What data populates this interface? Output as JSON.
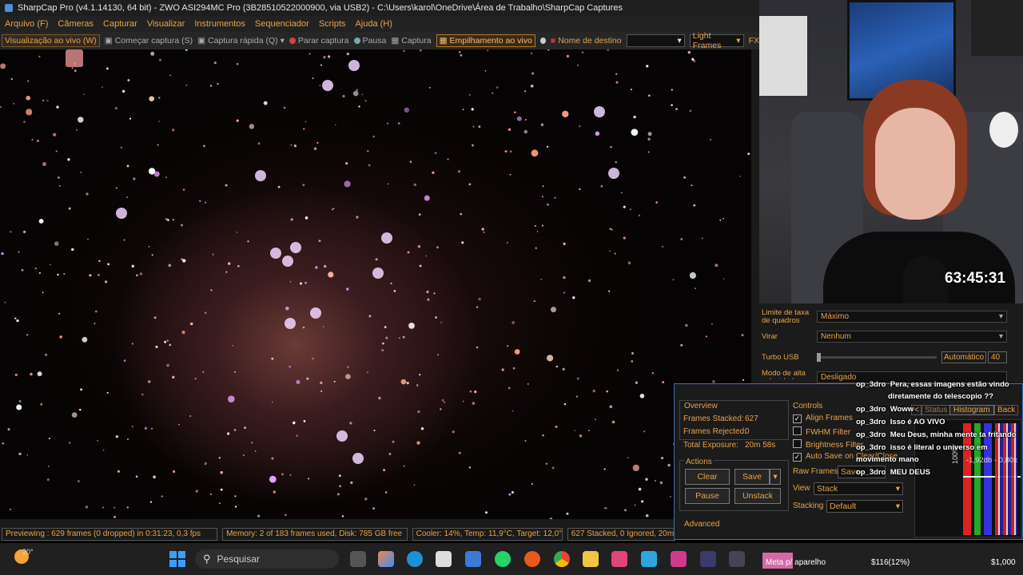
{
  "titlebar": {
    "title": "SharpCap Pro (v4.1.14130, 64 bit) - ZWO ASI294MC Pro (3B28510522000900, via USB2) - C:\\Users\\karol\\OneDrive\\Área de Trabalho\\SharpCap Captures"
  },
  "menu": [
    "Arquivo (F)",
    "Câmeras",
    "Capturar",
    "Visualizar",
    "Instrumentos",
    "Sequenciador",
    "Scripts",
    "Ajuda (H)"
  ],
  "toolbar": {
    "live_view": "Visualização ao vivo (W)",
    "start_capture": "Começar captura (S)",
    "quick_capture": "Captura rápida (Q)",
    "stop_capture": "Parar captura",
    "pause": "Pausa",
    "capture": "Captura",
    "live_stack": "Empilhamento ao vivo",
    "target_name": "Nome de destino",
    "target_value": "",
    "frame_type": "Light Frames",
    "fx": "FX"
  },
  "statusbar": {
    "preview": "Previewing : 629 frames (0 dropped) in 0:31:23, 0,3 fps",
    "memory": "Memory: 2 of 183 frames used, Disk: 785 GB free",
    "cooler": "Cooler: 14%, Temp: 11,9°C, Target: 12,0°C",
    "stack": "627 Stacked, 0 Ignored, 20m 5"
  },
  "webcam": {
    "timer": "63:45:31"
  },
  "settings": {
    "frame_rate_label": "Limite de taxa de quadros",
    "frame_rate_value": "Máximo",
    "flip_label": "Virar",
    "flip_value": "Nenhum",
    "usb_label": "Turbo USB",
    "usb_auto": "Automático",
    "usb_value": "40",
    "highspeed_label": "Modo de alta velocidade",
    "highspeed_value": "Desligado"
  },
  "stacking": {
    "overview_title": "Overview",
    "frames_stacked_label": "Frames Stacked:",
    "frames_stacked": "627",
    "frames_rejected_label": "Frames Rejected:",
    "frames_rejected": "0",
    "total_exposure_label": "Total Exposure:",
    "total_exposure": "20m 58s",
    "actions_title": "Actions",
    "clear": "Clear",
    "save": "Save",
    "pause": "Pause",
    "unstack": "Unstack",
    "advanced": "Advanced",
    "controls_title": "Controls",
    "align_frames": "Align Frames",
    "fwhm_filter": "FWHM Filter",
    "brightness_filter": "Brightness Filter",
    "auto_save": "Auto Save on Clear/Close",
    "raw_frames_label": "Raw Frames",
    "raw_frames_value": "Save",
    "view_label": "View",
    "view_value": "Stack",
    "stacking_label": "Stacking",
    "stacking_value": "Default",
    "tab_prev": "<",
    "tab_status": "Status",
    "tab_histogram": "Histogram",
    "tab_back": "Back",
    "db_readout": "-1,92db - 0,80x",
    "percent": "100%"
  },
  "chat": [
    {
      "user": "op_3dro",
      "msg": "Pera, essas imagens estão vindo"
    },
    {
      "user": "",
      "msg": "diretamente do telescopio ??"
    },
    {
      "user": "op_3dro",
      "msg": "Woww"
    },
    {
      "user": "op_3dro",
      "msg": "Isso é AO VIVO"
    },
    {
      "user": "op_3dro",
      "msg": "Meu Deus, minha mente ta fritando"
    },
    {
      "user": "op_3dro",
      "msg": "isso é literal o universo em"
    },
    {
      "user": "",
      "msg": "movimento mano"
    },
    {
      "user": "op_3dro",
      "msg": "MEU DEUS"
    }
  ],
  "taskbar": {
    "temperature": "20°",
    "search_placeholder": "Pesquisar",
    "notif": "Meta p/ aparelho",
    "money1": "$116(12%)",
    "money2": "$1,000"
  },
  "colors": {
    "accent": "#e8a34a",
    "panel_border": "#3b6fb6"
  }
}
